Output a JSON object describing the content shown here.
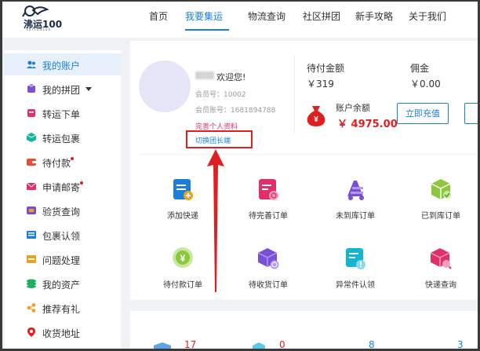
{
  "logo": {
    "text": "沸运100",
    "sub": "FEIYUN100"
  },
  "nav": {
    "items": [
      "首页",
      "我要集运",
      "物流查询",
      "社区拼团",
      "新手攻略",
      "关于我们"
    ],
    "active_index": 1
  },
  "sidebar": {
    "items": [
      {
        "label": "我的账户",
        "icon": "users-icon",
        "color": "#1a7fd8",
        "active": true
      },
      {
        "label": "我的拼团",
        "icon": "group-icon",
        "color": "#7a4fd8",
        "caret": true
      },
      {
        "label": "转运下单",
        "icon": "order-icon",
        "color": "#e0306a"
      },
      {
        "label": "转运包裹",
        "icon": "package-icon",
        "color": "#13b5a0"
      },
      {
        "label": "待付款",
        "icon": "wallet-icon",
        "color": "#e05040",
        "dot": true
      },
      {
        "label": "申请邮寄",
        "icon": "mail-icon",
        "color": "#e0306a",
        "dot": true
      },
      {
        "label": "验货查询",
        "icon": "inspect-icon",
        "color": "#7a4fd8"
      },
      {
        "label": "包裹认领",
        "icon": "claim-icon",
        "color": "#1a7fd8"
      },
      {
        "label": "问题处理",
        "icon": "problem-icon",
        "color": "#f0a020"
      },
      {
        "label": "我的资产",
        "icon": "assets-icon",
        "color": "#20b060"
      },
      {
        "label": "推荐有礼",
        "icon": "share-icon",
        "color": "#f0a020"
      },
      {
        "label": "收货地址",
        "icon": "location-icon",
        "color": "#e02020"
      }
    ]
  },
  "profile": {
    "welcome": "欢迎您!",
    "member_no": "会员号：10002",
    "member_account": "会员账号：1681894788",
    "complete_profile": "完善个人资料",
    "switch_leader": "切换团长端"
  },
  "stats": {
    "pending_label": "待付金额",
    "pending_value": "￥319",
    "commission_label": "佣金",
    "commission_value": "￥0.00",
    "balance_label": "账户余额",
    "balance_value": "￥ 4975.00",
    "recharge_label": "立即充值"
  },
  "quick_actions": [
    {
      "label": "添加快递",
      "icon": "add-express-icon"
    },
    {
      "label": "待完善订单",
      "icon": "incomplete-order-icon"
    },
    {
      "label": "未到库订单",
      "icon": "not-arrived-icon"
    },
    {
      "label": "已到库订单",
      "icon": "arrived-icon"
    },
    {
      "label": "待付款订单",
      "icon": "unpaid-order-icon"
    },
    {
      "label": "待收货订单",
      "icon": "to-receive-icon"
    },
    {
      "label": "异常件认领",
      "icon": "exception-claim-icon"
    },
    {
      "label": "快递查询",
      "icon": "express-query-icon"
    }
  ],
  "bottom_counts": [
    "17",
    "0",
    "8",
    "3"
  ],
  "colors": {
    "accent": "#1a7fd8",
    "danger": "#e02020",
    "link_pink": "#e0306a"
  }
}
